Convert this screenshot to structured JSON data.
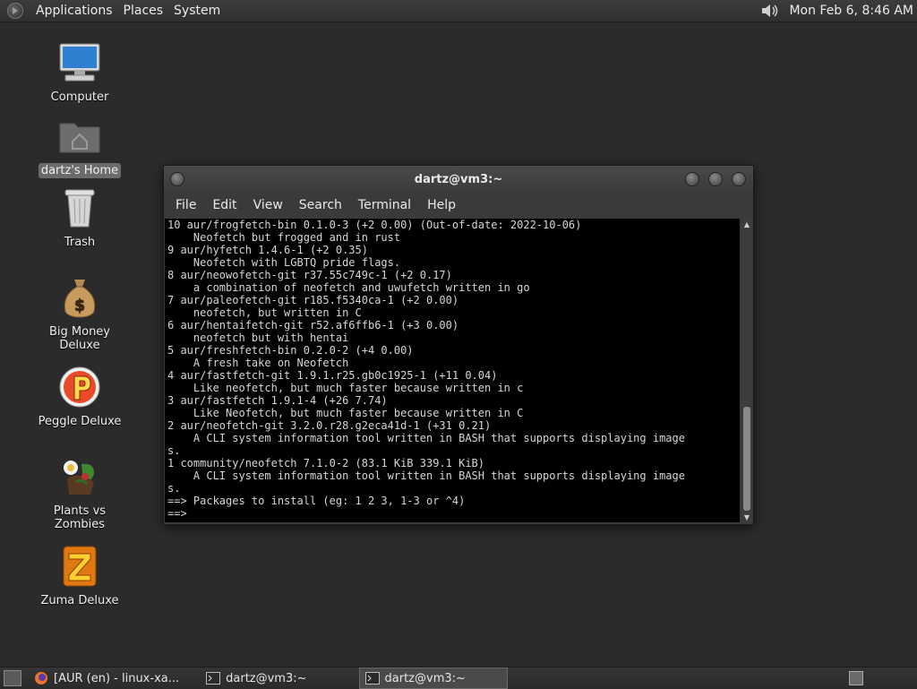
{
  "top_panel": {
    "menus": [
      "Applications",
      "Places",
      "System"
    ],
    "clock": "Mon Feb  6,  8:46 AM"
  },
  "desktop": {
    "icons": [
      {
        "label": "Computer",
        "icon": "computer-icon"
      },
      {
        "label": "dartz's Home",
        "icon": "home-folder-icon"
      },
      {
        "label": "Trash",
        "icon": "trash-icon"
      },
      {
        "label": "Big Money Deluxe",
        "icon": "money-bag-icon"
      },
      {
        "label": "Peggle Deluxe",
        "icon": "peggle-icon"
      },
      {
        "label": "Plants vs Zombies",
        "icon": "plants-vs-zombies-icon"
      },
      {
        "label": "Zuma Deluxe",
        "icon": "zuma-icon"
      }
    ]
  },
  "terminal": {
    "title": "dartz@vm3:~",
    "menu": [
      "File",
      "Edit",
      "View",
      "Search",
      "Terminal",
      "Help"
    ],
    "lines": [
      "10 aur/frogfetch-bin 0.1.0-3 (+2 0.00) (Out-of-date: 2022-10-06)",
      "    Neofetch but frogged and in rust",
      "9 aur/hyfetch 1.4.6-1 (+2 0.35)",
      "    Neofetch with LGBTQ pride flags.",
      "8 aur/neowofetch-git r37.55c749c-1 (+2 0.17)",
      "    a combination of neofetch and uwufetch written in go",
      "7 aur/paleofetch-git r185.f5340ca-1 (+2 0.00)",
      "    neofetch, but written in C",
      "6 aur/hentaifetch-git r52.af6ffb6-1 (+3 0.00)",
      "    neofetch but with hentai",
      "5 aur/freshfetch-bin 0.2.0-2 (+4 0.00)",
      "    A fresh take on Neofetch",
      "4 aur/fastfetch-git 1.9.1.r25.gb0c1925-1 (+11 0.04)",
      "    Like neofetch, but much faster because written in c",
      "3 aur/fastfetch 1.9.1-4 (+26 7.74)",
      "    Like Neofetch, but much faster because written in C",
      "2 aur/neofetch-git 3.2.0.r28.g2eca41d-1 (+31 0.21)",
      "    A CLI system information tool written in BASH that supports displaying image",
      "s.",
      "1 community/neofetch 7.1.0-2 (83.1 KiB 339.1 KiB)",
      "    A CLI system information tool written in BASH that supports displaying image",
      "s.",
      "==> Packages to install (eg: 1 2 3, 1-3 or ^4)",
      "==> "
    ]
  },
  "taskbar": {
    "tasks": [
      {
        "label": "[AUR (en) - linux-xa...",
        "icon": "firefox-icon",
        "active": false
      },
      {
        "label": "dartz@vm3:~",
        "icon": "terminal-icon",
        "active": false
      },
      {
        "label": "dartz@vm3:~",
        "icon": "terminal-icon",
        "active": true
      }
    ]
  }
}
